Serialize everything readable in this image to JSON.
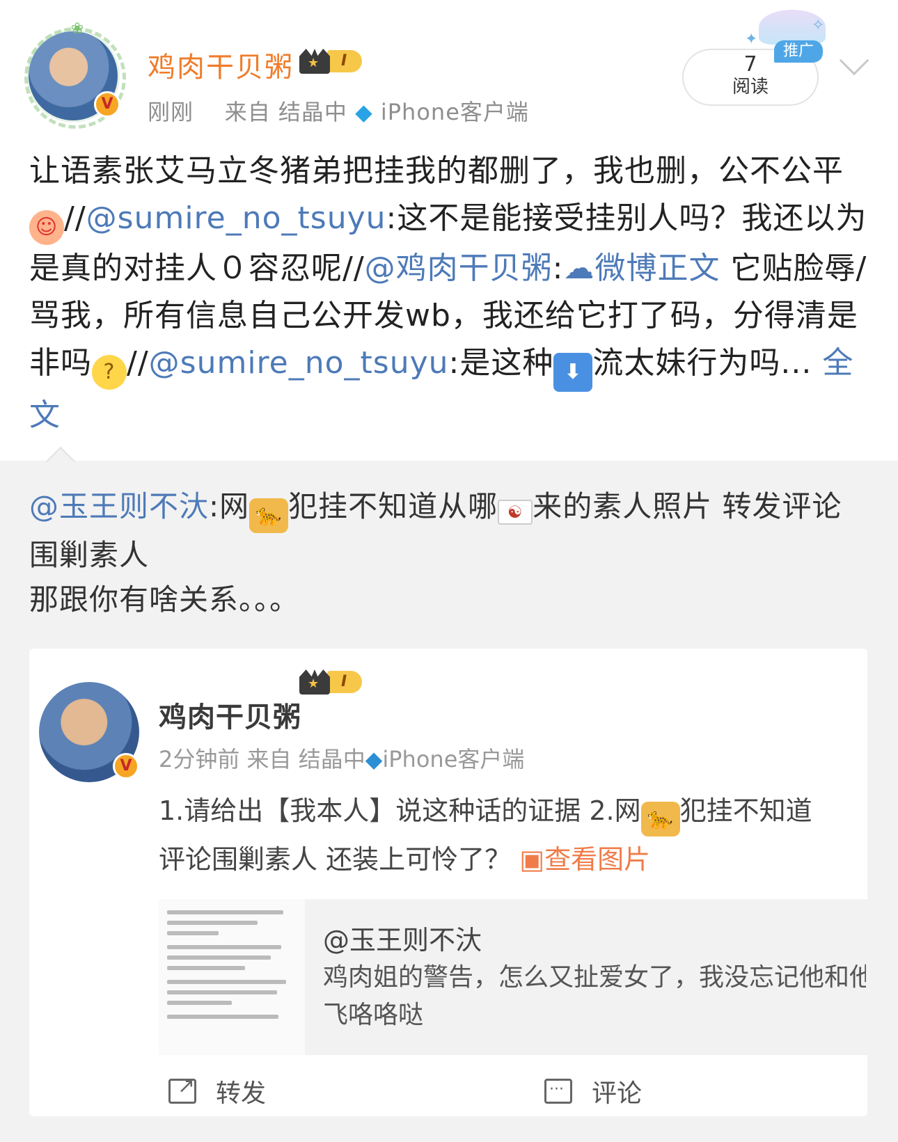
{
  "post": {
    "username": "鸡肉干贝粥",
    "level": "I",
    "time": "刚刚",
    "source_prefix": "来自",
    "source_name": "结晶中",
    "source_client": "iPhone客户端",
    "read_count": "7",
    "read_label": "阅读",
    "promo_tag": "推广",
    "text": {
      "p1": "让语素张艾马立冬猪弟把挂我的都删了，我也删，公不公平",
      "p2": "//",
      "m1": "@sumire_no_tsuyu",
      "p3": ":这不是能接受挂别人吗？我还以为是真的对挂人０容忍呢//",
      "m2": "@鸡肉干贝粥",
      "p4": ":",
      "m3": "微博正文",
      "p5": " 它贴脸辱/骂我，所有信息自己公开发wb，我还给它打了码，分得清是非吗",
      "p6": "//",
      "m4": "@sumire_no_tsuyu",
      "p7": ":是这种",
      "p8": "流太妹行为吗...",
      "more": "全文"
    }
  },
  "repost": {
    "mention": "@玉王则不汏",
    "t1": ":网",
    "t2": "犯挂不知道从哪",
    "t3": "来的素人照片 转发评论围剿素人",
    "t4": "那跟你有啥关系。。。"
  },
  "inner": {
    "username": "鸡肉干贝粥",
    "level": "I",
    "time": "2分钟前",
    "source_prefix": "来自",
    "source_name": "结晶中",
    "source_client": "iPhone客户端",
    "line1_a": "1.请给出【我本人】说这种话的证据 2.网",
    "line1_b": "犯挂不知道",
    "line2": "评论围剿素人 还装上可怜了？",
    "view_image": "查看图片",
    "quote_user": "@玉王则不汏",
    "quote_line1": "鸡肉姐的警告，怎么又扯爱女了，我没忘记他和他",
    "quote_line2": "飞咯咯哒",
    "share_label": "转发",
    "comment_label": "评论"
  },
  "colors": {
    "username": "#f07c2a",
    "link": "#4d7ab8",
    "view_image": "#f07c4a",
    "background": "#f2f2f2"
  },
  "icons": {
    "pig_emoji": "pig-face-emoji",
    "think_emoji": "thinking-face-emoji",
    "down_arrow_emoji": "down-arrow-emoji",
    "leopard_emoji": "leopard-emoji",
    "korea_flag_emoji": "korea-flag-emoji",
    "weibo_link_icon": "weibo-link-icon",
    "image_icon": "image-icon",
    "share_icon": "share-icon",
    "comment_icon": "comment-icon",
    "chevron": "chevron-down-icon",
    "crown": "crown-icon",
    "verified": "verified-badge-icon",
    "diamond": "diamond-icon"
  }
}
